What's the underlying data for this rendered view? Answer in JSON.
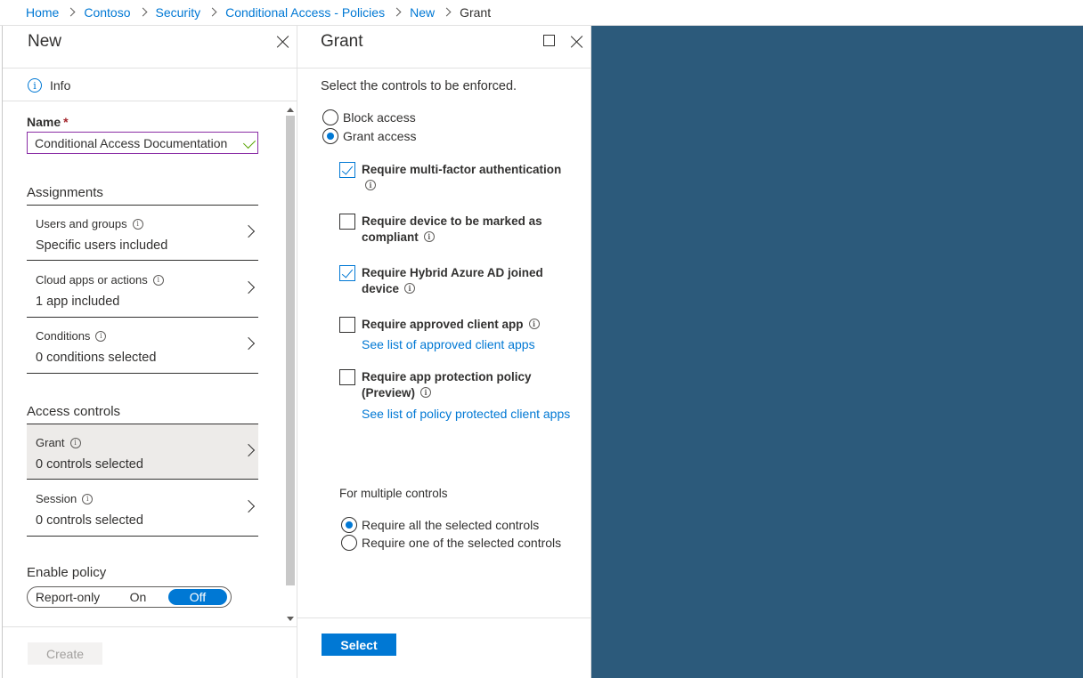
{
  "breadcrumb": {
    "items": [
      "Home",
      "Contoso",
      "Security",
      "Conditional Access - Policies",
      "New"
    ],
    "current": "Grant"
  },
  "left_blade": {
    "title": "New",
    "info_label": "Info",
    "name_label": "Name",
    "required_marker": "*",
    "name_value": "Conditional Access Documentation",
    "assignments_label": "Assignments",
    "assignments": [
      {
        "title": "Users and groups",
        "value": "Specific users included"
      },
      {
        "title": "Cloud apps or actions",
        "value": "1 app included"
      },
      {
        "title": "Conditions",
        "value": "0 conditions selected"
      }
    ],
    "access_controls_label": "Access controls",
    "access_controls": [
      {
        "title": "Grant",
        "value": "0 controls selected"
      },
      {
        "title": "Session",
        "value": "0 controls selected"
      }
    ],
    "enable_policy_label": "Enable policy",
    "toggle_options": [
      "Report-only",
      "On",
      "Off"
    ],
    "toggle_selected": "Off",
    "create_label": "Create"
  },
  "grant_blade": {
    "title": "Grant",
    "instruction": "Select the controls to be enforced.",
    "access_options": [
      "Block access",
      "Grant access"
    ],
    "access_selected": "Grant access",
    "controls": [
      {
        "label_line1": "Require multi-factor authentication",
        "label_line2": "",
        "checked": true
      },
      {
        "label_line1": "Require device to be marked as",
        "label_line2": "compliant",
        "checked": false
      },
      {
        "label_line1": "Require Hybrid Azure AD joined",
        "label_line2": "device",
        "checked": true
      },
      {
        "label_line1": "Require approved client app",
        "label_line2": "",
        "checked": false,
        "link": "See list of approved client apps"
      },
      {
        "label_line1": "Require app protection policy",
        "label_line2": "(Preview)",
        "checked": false,
        "link": "See list of policy protected client apps"
      }
    ],
    "multiple_label": "For multiple controls",
    "multiple_options": [
      "Require all the selected controls",
      "Require one of the selected controls"
    ],
    "multiple_selected": "Require all the selected controls",
    "select_label": "Select"
  },
  "colors": {
    "accent": "#0078d4",
    "background_panel": "#2c5a7b",
    "input_border": "#8a2da5"
  }
}
